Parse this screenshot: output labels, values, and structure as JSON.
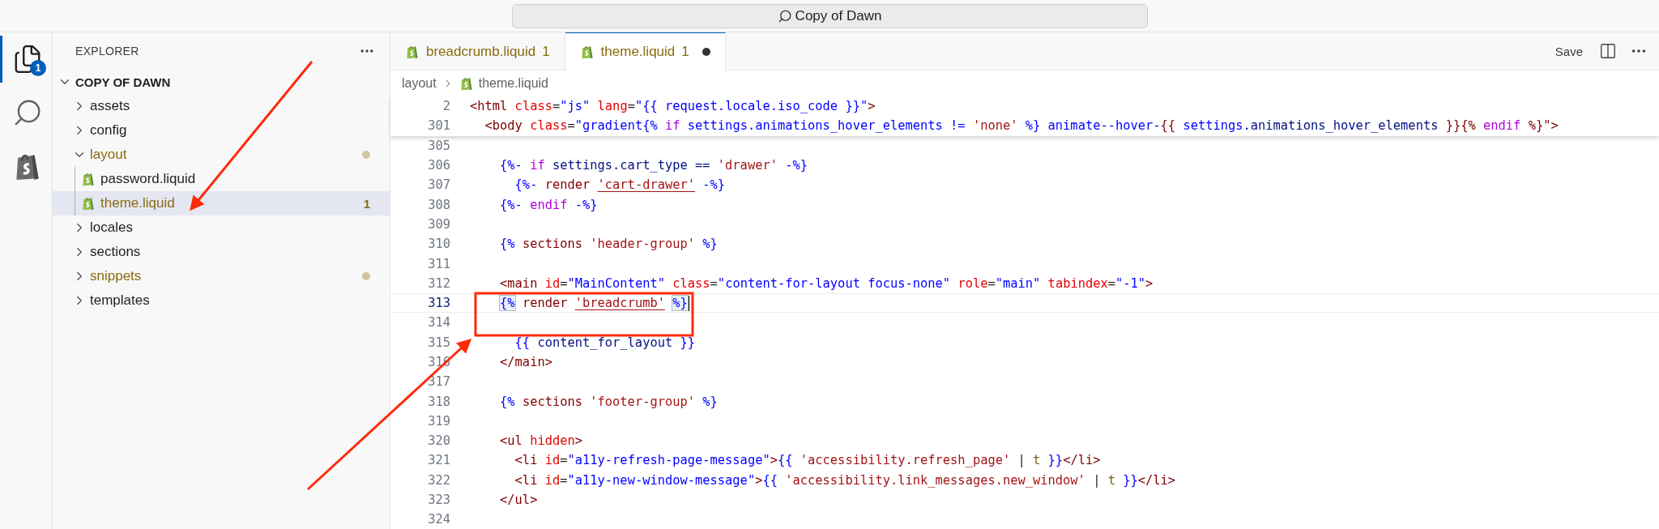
{
  "title_bar": {
    "search": "Copy of Dawn"
  },
  "activity_bar": [
    {
      "kind": "explorer",
      "selected": true,
      "badge": "1"
    },
    {
      "kind": "search",
      "selected": false
    },
    {
      "kind": "shopify",
      "selected": false
    }
  ],
  "explorer": {
    "title": "EXPLORER",
    "root": {
      "label": "COPY OF DAWN",
      "expanded": true,
      "children": [
        {
          "label": "assets",
          "kind": "folder",
          "expanded": false,
          "modified": false,
          "selected": false
        },
        {
          "label": "config",
          "kind": "folder",
          "expanded": false,
          "modified": false,
          "selected": false
        },
        {
          "label": "layout",
          "kind": "folder",
          "expanded": true,
          "modified": true,
          "selected": false,
          "children": [
            {
              "label": "password.liquid",
              "kind": "file",
              "modified": false,
              "selected": false
            },
            {
              "label": "theme.liquid",
              "kind": "file",
              "modified": true,
              "selected": true,
              "problems": "1"
            }
          ]
        },
        {
          "label": "locales",
          "kind": "folder",
          "expanded": false,
          "modified": false,
          "selected": false
        },
        {
          "label": "sections",
          "kind": "folder",
          "expanded": false,
          "modified": false,
          "selected": false
        },
        {
          "label": "snippets",
          "kind": "folder",
          "expanded": false,
          "modified": true,
          "selected": false
        },
        {
          "label": "templates",
          "kind": "folder",
          "expanded": false,
          "modified": false,
          "selected": false
        }
      ]
    }
  },
  "tabs": [
    {
      "label": "breadcrumb.liquid",
      "problems": "1",
      "selected": false,
      "dirty": false
    },
    {
      "label": "theme.liquid",
      "problems": "1",
      "selected": true,
      "dirty": true
    }
  ],
  "editor_actions": {
    "save": "Save"
  },
  "breadcrumb": [
    "layout",
    "theme.liquid"
  ],
  "sticky_lines": [
    {
      "number": "2",
      "tokens": [
        {
          "kind": "tag",
          "text": "<html "
        },
        {
          "kind": "attr",
          "text": "class"
        },
        {
          "kind": "plain",
          "text": "="
        },
        {
          "kind": "string",
          "text": "\"js\" "
        },
        {
          "kind": "attr",
          "text": "lang"
        },
        {
          "kind": "plain",
          "text": "="
        },
        {
          "kind": "string",
          "text": "\"{{ request.locale.iso_code }}\""
        },
        {
          "kind": "tag",
          "text": ">"
        }
      ]
    },
    {
      "number": "301",
      "tokens": [
        {
          "kind": "tag",
          "text": "  <body "
        },
        {
          "kind": "attr",
          "text": "class"
        },
        {
          "kind": "plain",
          "text": "="
        },
        {
          "kind": "string",
          "text": "\"gradient{% "
        },
        {
          "kind": "keyword",
          "text": "if"
        },
        {
          "kind": "string",
          "text": " settings.animations_hover_elements != "
        },
        {
          "kind": "lstring",
          "text": "'none'"
        },
        {
          "kind": "string",
          "text": " %} animate--hover-"
        },
        {
          "kind": "tag",
          "text": "{{ "
        },
        {
          "kind": "string",
          "text": "settings"
        },
        {
          "kind": "var",
          "text": ".animations_hover_elements"
        },
        {
          "kind": "tag",
          "text": " }}{% "
        },
        {
          "kind": "keyword",
          "text": "endif"
        },
        {
          "kind": "tag",
          "text": " %}\">"
        }
      ]
    }
  ],
  "lines": [
    {
      "number": "305",
      "current": false
    },
    {
      "number": "306",
      "current": false,
      "tokens": [
        {
          "kind": "delim",
          "text": "    {%- "
        },
        {
          "kind": "keyword",
          "text": "if"
        },
        {
          "kind": "var",
          "text": " settings.cart_type == "
        },
        {
          "kind": "lstring",
          "text": "'drawer'"
        },
        {
          "kind": "delim",
          "text": " -%}"
        }
      ]
    },
    {
      "number": "307",
      "current": false,
      "tokens": [
        {
          "kind": "delim",
          "text": "      {%- "
        },
        {
          "kind": "tag",
          "text": "render "
        },
        {
          "kind": "link",
          "text": "'cart-drawer'"
        },
        {
          "kind": "delim",
          "text": " -%}"
        }
      ]
    },
    {
      "number": "308",
      "current": false,
      "tokens": [
        {
          "kind": "delim",
          "text": "    {%- "
        },
        {
          "kind": "keyword",
          "text": "endif"
        },
        {
          "kind": "delim",
          "text": " -%}"
        }
      ]
    },
    {
      "number": "309",
      "current": false
    },
    {
      "number": "310",
      "current": false,
      "tokens": [
        {
          "kind": "delim",
          "text": "    {% "
        },
        {
          "kind": "tag",
          "text": "sections "
        },
        {
          "kind": "lstring",
          "text": "'header-group' "
        },
        {
          "kind": "delim",
          "text": "%}"
        }
      ]
    },
    {
      "number": "311",
      "current": false
    },
    {
      "number": "312",
      "current": false,
      "tokens": [
        {
          "kind": "tag",
          "text": "    <main "
        },
        {
          "kind": "attr",
          "text": "id"
        },
        {
          "kind": "plain",
          "text": "="
        },
        {
          "kind": "string",
          "text": "\"MainContent\" "
        },
        {
          "kind": "attr",
          "text": "class"
        },
        {
          "kind": "plain",
          "text": "="
        },
        {
          "kind": "string",
          "text": "\"content-for-layout focus-none\" "
        },
        {
          "kind": "attr",
          "text": "role"
        },
        {
          "kind": "plain",
          "text": "="
        },
        {
          "kind": "string",
          "text": "\"main\" "
        },
        {
          "kind": "attr",
          "text": "tabindex"
        },
        {
          "kind": "plain",
          "text": "="
        },
        {
          "kind": "string",
          "text": "\"-1\""
        },
        {
          "kind": "tag",
          "text": ">"
        }
      ]
    },
    {
      "number": "313",
      "current": true,
      "tokens": [
        {
          "kind": "bracket",
          "text": "    {%"
        },
        {
          "kind": "tag",
          "text": " render "
        },
        {
          "kind": "link",
          "text": "'breadcrumb'"
        },
        {
          "kind": "bracket",
          "text": " %}"
        }
      ]
    },
    {
      "number": "314",
      "current": false
    },
    {
      "number": "315",
      "current": false,
      "tokens": [
        {
          "kind": "delim",
          "text": "      {{ "
        },
        {
          "kind": "var",
          "text": "content_for_layout"
        },
        {
          "kind": "delim",
          "text": " }}"
        }
      ]
    },
    {
      "number": "316",
      "current": false,
      "tokens": [
        {
          "kind": "tag",
          "text": "    </main>"
        }
      ]
    },
    {
      "number": "317",
      "current": false
    },
    {
      "number": "318",
      "current": false,
      "tokens": [
        {
          "kind": "delim",
          "text": "    {% "
        },
        {
          "kind": "tag",
          "text": "sections "
        },
        {
          "kind": "lstring",
          "text": "'footer-group' "
        },
        {
          "kind": "delim",
          "text": "%}"
        }
      ]
    },
    {
      "number": "319",
      "current": false
    },
    {
      "number": "320",
      "current": false,
      "tokens": [
        {
          "kind": "tag",
          "text": "    <ul "
        },
        {
          "kind": "attr",
          "text": "hidden"
        },
        {
          "kind": "tag",
          "text": ">"
        }
      ]
    },
    {
      "number": "321",
      "current": false,
      "tokens": [
        {
          "kind": "tag",
          "text": "      <li "
        },
        {
          "kind": "attr",
          "text": "id"
        },
        {
          "kind": "plain",
          "text": "="
        },
        {
          "kind": "string",
          "text": "\"a11y-refresh-page-message\""
        },
        {
          "kind": "tag",
          "text": ">"
        },
        {
          "kind": "delim",
          "text": "{{ "
        },
        {
          "kind": "lstring",
          "text": "'accessibility.refresh_page' "
        },
        {
          "kind": "plain",
          "text": "| "
        },
        {
          "kind": "filter",
          "text": "t"
        },
        {
          "kind": "delim",
          "text": " }}"
        },
        {
          "kind": "tag",
          "text": "</li>"
        }
      ]
    },
    {
      "number": "322",
      "current": false,
      "tokens": [
        {
          "kind": "tag",
          "text": "      <li "
        },
        {
          "kind": "attr",
          "text": "id"
        },
        {
          "kind": "plain",
          "text": "="
        },
        {
          "kind": "string",
          "text": "\"a11y-new-window-message\""
        },
        {
          "kind": "tag",
          "text": ">"
        },
        {
          "kind": "delim",
          "text": "{{ "
        },
        {
          "kind": "lstring",
          "text": "'accessibility.link_messages.new_window' "
        },
        {
          "kind": "plain",
          "text": "| "
        },
        {
          "kind": "filter",
          "text": "t"
        },
        {
          "kind": "delim",
          "text": " }}"
        },
        {
          "kind": "tag",
          "text": "</li>"
        }
      ]
    },
    {
      "number": "323",
      "current": false,
      "tokens": [
        {
          "kind": "tag",
          "text": "    </ul>"
        }
      ]
    },
    {
      "number": "324",
      "current": false
    }
  ]
}
